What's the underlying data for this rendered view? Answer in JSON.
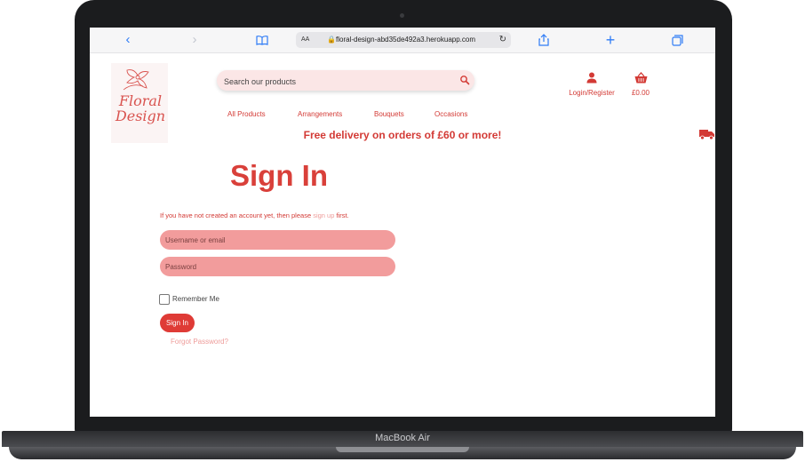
{
  "device": {
    "label": "MacBook Air"
  },
  "browser": {
    "url": "floral-design-abd35de492a3.herokuapp.com",
    "aa_label": "AA",
    "icons": [
      "back-icon",
      "forward-icon",
      "book-icon",
      "lock-icon",
      "reload-icon",
      "share-icon",
      "new-tab-icon",
      "tabs-icon"
    ]
  },
  "site": {
    "logo_text_line1": "Floral",
    "logo_text_line2": "Design",
    "search_placeholder": "Search our products",
    "nav": [
      "All Products",
      "Arrangements",
      "Bouquets",
      "Occasions"
    ],
    "account_label": "Login/Register",
    "cart_total": "£0.00",
    "delivery_banner": "Free delivery on orders of £60 or more!"
  },
  "signin": {
    "title": "Sign In",
    "note_prefix": "If you have not created an account yet, then please ",
    "note_link": "sign up",
    "note_suffix": " first.",
    "username_placeholder": "Username or email",
    "password_placeholder": "Password",
    "remember_label": "Remember Me",
    "button_label": "Sign In",
    "forgot_label": "Forgot Password?"
  },
  "colors": {
    "accent": "#d9403a",
    "field": "#f29c9c",
    "link": "#ee9c9a",
    "search_bg": "#fbe6e6"
  }
}
